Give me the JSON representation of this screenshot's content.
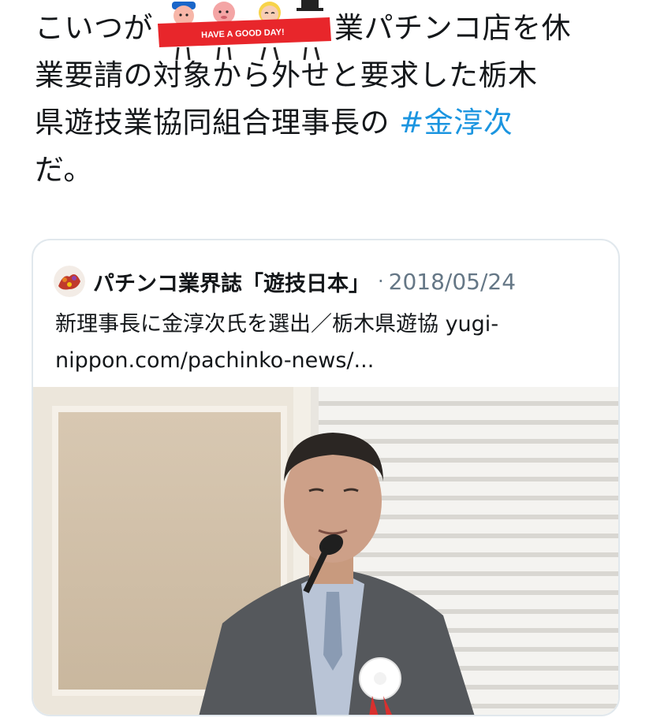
{
  "tweet": {
    "lines": [
      "こいつが",
      "業パチンコ店を休",
      "業要請の対象から外せと要求した栃木",
      "県遊技業協同組合理事長の ",
      "だ。"
    ],
    "hashtag": "#金淳次",
    "sticker_text": "HAVE A GOOD DAY!"
  },
  "quoted": {
    "author": "パチンコ業界誌「遊技日本」",
    "separator": "·",
    "date": "2018/05/24",
    "text_line1": "新理事長に金淳次氏を選出／栃木県遊協 yugi-",
    "text_line2": "nippon.com/pachinko-news/..."
  },
  "colors": {
    "link": "#1b95e0",
    "text": "#14171a",
    "muted": "#657786",
    "border": "#e1e8ed"
  }
}
